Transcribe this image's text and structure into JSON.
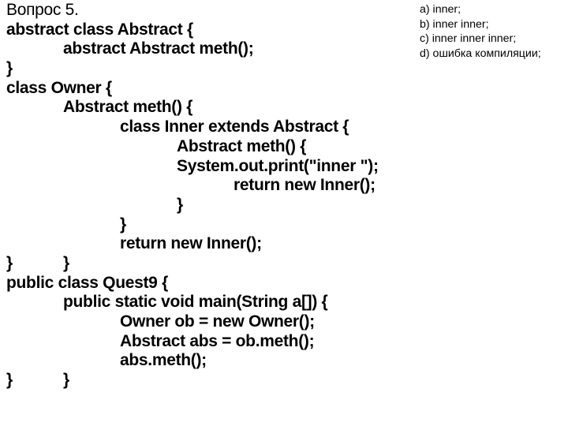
{
  "slide": {
    "title": "Вопрос 5.",
    "code_lines": [
      {
        "indent": 0,
        "segments": [
          "abstract class Abstract {"
        ]
      },
      {
        "indent": 1,
        "segments": [
          "abstract Abstract meth();"
        ]
      },
      {
        "indent": 0,
        "segments": [
          "}"
        ]
      },
      {
        "indent": 0,
        "segments": [
          "class Owner {"
        ]
      },
      {
        "indent": 1,
        "segments": [
          "Abstract meth() {"
        ]
      },
      {
        "indent": 2,
        "segments": [
          "class Inner extends Abstract {"
        ]
      },
      {
        "indent": 3,
        "segments": [
          "Abstract meth() {"
        ]
      },
      {
        "indent": 3,
        "segments": [
          "System.out.print(\"inner \");"
        ]
      },
      {
        "indent": 4,
        "segments": [
          "return new Inner();"
        ]
      },
      {
        "indent": 3,
        "segments": [
          "}"
        ]
      },
      {
        "indent": 2,
        "segments": [
          "}"
        ]
      },
      {
        "indent": 2,
        "segments": [
          "return new Inner();"
        ]
      },
      {
        "indent": 0,
        "segments": [
          "}",
          "}"
        ]
      },
      {
        "indent": 0,
        "segments": [
          "public ",
          "class Quest9 {"
        ]
      },
      {
        "indent": 1,
        "segments": [
          "public static void main(String a[]) {"
        ]
      },
      {
        "indent": 2,
        "segments": [
          "Owner ob = new Owner();"
        ]
      },
      {
        "indent": 2,
        "segments": [
          "Abstract abs = ob.meth();"
        ]
      },
      {
        "indent": 2,
        "segments": [
          "abs.meth();"
        ]
      },
      {
        "indent": 0,
        "segments": [
          "}",
          "}"
        ]
      }
    ],
    "answers": [
      "a) inner;",
      "b) inner inner;",
      "c) inner inner inner;",
      "d) ошибка компиляции;"
    ]
  }
}
